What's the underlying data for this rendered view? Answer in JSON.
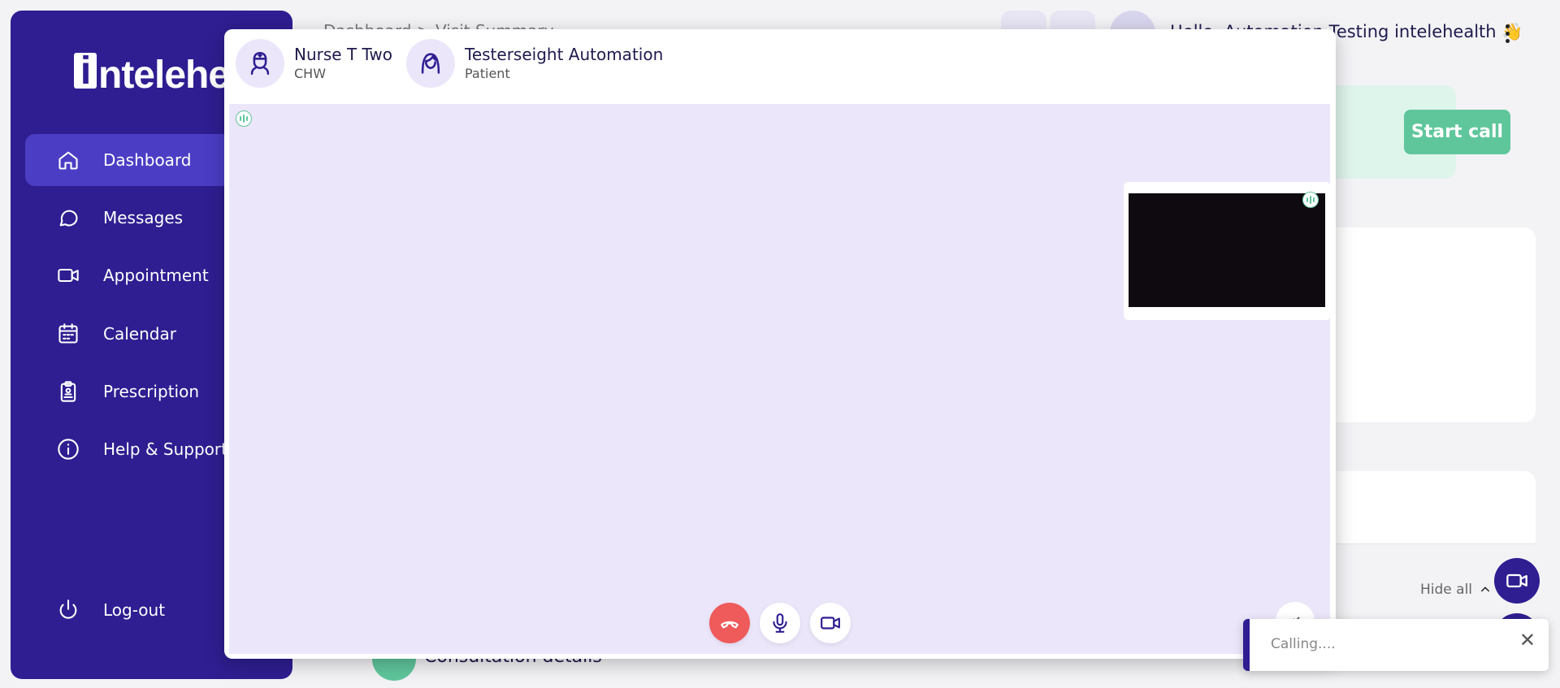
{
  "app": {
    "logo_text": "intelehealth"
  },
  "sidebar": {
    "items": [
      {
        "label": "Dashboard",
        "icon": "home-icon",
        "active": true
      },
      {
        "label": "Messages",
        "icon": "chat-icon"
      },
      {
        "label": "Appointment",
        "icon": "video-icon"
      },
      {
        "label": "Calendar",
        "icon": "calendar-icon"
      },
      {
        "label": "Prescription",
        "icon": "clipboard-icon"
      },
      {
        "label": "Help & Support",
        "icon": "info-icon"
      }
    ],
    "logout_label": "Log-out"
  },
  "header": {
    "breadcrumb": "Dashboard > Visit Summary",
    "greeting": "Hello, Automation Testing intelehealth 👋"
  },
  "banner": {
    "start_call_label": "Start call"
  },
  "main": {
    "hide_all_label": "Hide all",
    "section_title": "Consultation details"
  },
  "call": {
    "participants": [
      {
        "name": "Nurse T Two",
        "role": "CHW",
        "icon": "nurse-icon"
      },
      {
        "name": "Testerseight Automation",
        "role": "Patient",
        "icon": "patient-icon"
      }
    ],
    "controls": [
      "end-call",
      "microphone",
      "camera"
    ],
    "status_toast": "Calling...."
  },
  "colors": {
    "primary": "#2e1e91",
    "accent_green": "#5fc69c",
    "end_call_red": "#ef5a5a",
    "video_bg": "#ece6fa"
  }
}
